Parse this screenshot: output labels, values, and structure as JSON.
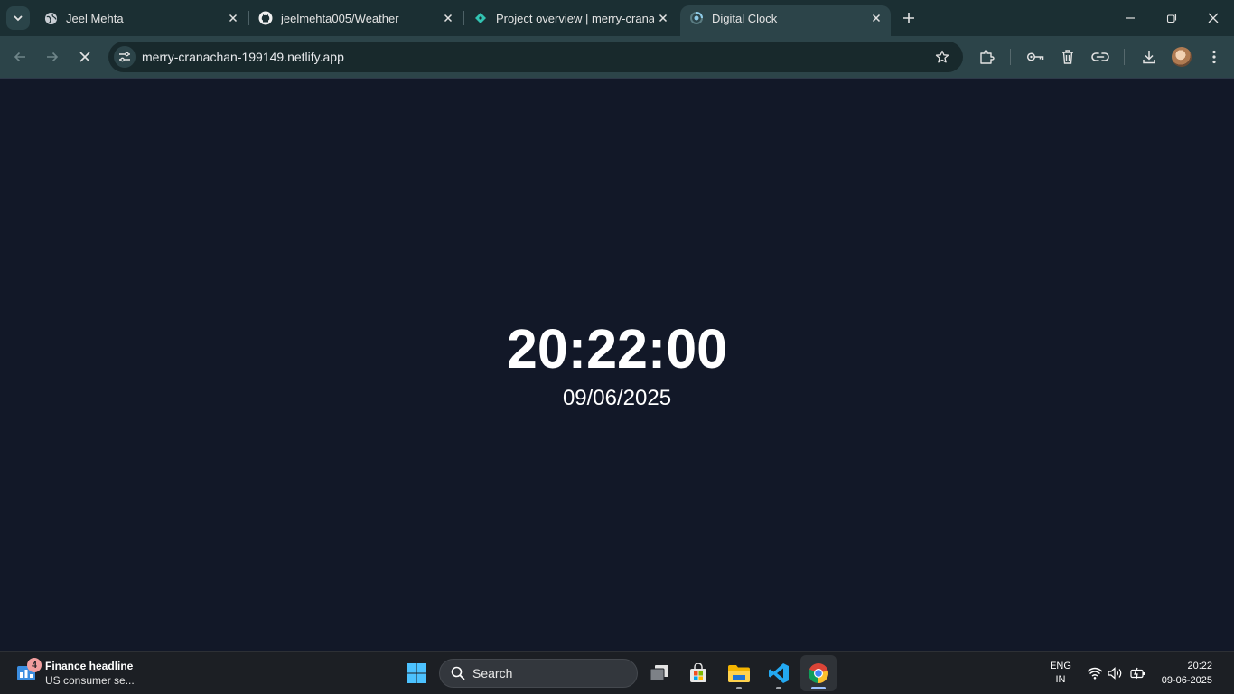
{
  "browser": {
    "tabs": [
      {
        "title": "Jeel Mehta",
        "icon": "globe-icon",
        "active": false
      },
      {
        "title": "jeelmehta005/Weather",
        "icon": "github-icon",
        "active": false
      },
      {
        "title": "Project overview | merry-cranac",
        "icon": "netlify-icon",
        "active": false
      },
      {
        "title": "Digital Clock",
        "icon": "loading-spinner-icon",
        "active": true
      }
    ],
    "url": "merry-cranachan-199149.netlify.app"
  },
  "page": {
    "time": "20:22:00",
    "date": "09/06/2025"
  },
  "taskbar": {
    "widget_badge": "4",
    "widget_title": "Finance headline",
    "widget_subtitle": "US consumer se...",
    "search_label": "Search",
    "lang_line1": "ENG",
    "lang_line2": "IN",
    "clock_time": "20:22",
    "clock_date": "09-06-2025"
  },
  "colors": {
    "page_background": "#121828",
    "tab_strip": "#1b2f33",
    "toolbar": "#2c4449"
  }
}
